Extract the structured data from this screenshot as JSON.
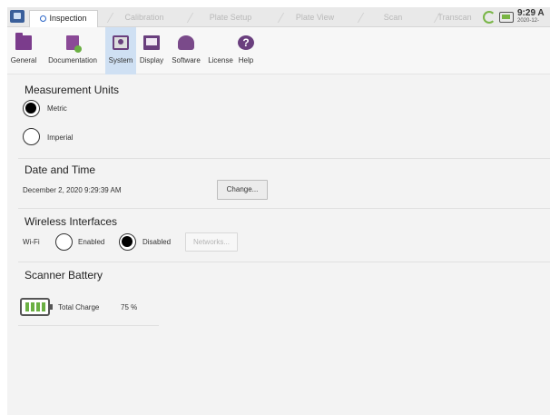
{
  "tabs": [
    {
      "label": "Inspection",
      "active": true
    },
    {
      "label": "Calibration",
      "active": false
    },
    {
      "label": "Plate Setup",
      "active": false
    },
    {
      "label": "Plate View",
      "active": false
    },
    {
      "label": "Scan",
      "active": false
    },
    {
      "label": "Transcan",
      "active": false
    }
  ],
  "status": {
    "time": "9:29 A",
    "date": "2020-12-"
  },
  "toolbar": [
    {
      "label": "General",
      "icon": "folder-icon"
    },
    {
      "label": "Documentation",
      "icon": "document-icon"
    },
    {
      "label": "System",
      "icon": "system-icon",
      "selected": true
    },
    {
      "label": "Display",
      "icon": "display-icon"
    },
    {
      "label": "Software",
      "icon": "software-icon"
    },
    {
      "label": "License",
      "icon": "license-icon"
    },
    {
      "label": "Help",
      "icon": "help-icon"
    }
  ],
  "measurement": {
    "title": "Measurement Units",
    "metric": "Metric",
    "imperial": "Imperial",
    "selected": "Metric"
  },
  "datetime": {
    "title": "Date and Time",
    "value": "December 2, 2020 9:29:39 AM",
    "change_label": "Change..."
  },
  "wireless": {
    "title": "Wireless Interfaces",
    "wifi_label": "Wi-Fi",
    "enabled_label": "Enabled",
    "disabled_label": "Disabled",
    "selected": "Disabled",
    "networks_label": "Networks..."
  },
  "scanner_battery": {
    "title": "Scanner Battery",
    "charge_label": "Total Charge",
    "charge_value": "75 %",
    "charge_fraction": 0.75
  },
  "colors": {
    "accent": "#2a64c6",
    "icon_purple": "#6a3f7e",
    "battery_green": "#6bb043",
    "selected_tool_bg": "#cfe0f3"
  }
}
